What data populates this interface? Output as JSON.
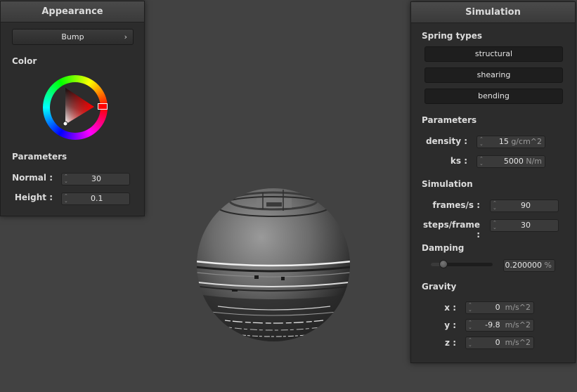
{
  "appearance": {
    "title": "Appearance",
    "shader_dropdown": "Bump",
    "color_label": "Color",
    "color_wheel": {
      "hue_color": "#ff0000"
    },
    "parameters_label": "Parameters",
    "normal": {
      "label": "Normal :",
      "value": "30"
    },
    "height": {
      "label": "Height :",
      "value": "0.1"
    }
  },
  "simulation": {
    "title": "Simulation",
    "spring_types_label": "Spring types",
    "spring_buttons": [
      "structural",
      "shearing",
      "bending"
    ],
    "parameters_label": "Parameters",
    "density": {
      "label": "density :",
      "value": "15",
      "unit": "g/cm^2"
    },
    "ks": {
      "label": "ks :",
      "value": "5000",
      "unit": "N/m"
    },
    "simulation_label": "Simulation",
    "frames_per_s": {
      "label": "frames/s :",
      "value": "90"
    },
    "steps_per_frame": {
      "label": "steps/frame :",
      "value": "30"
    },
    "damping_label": "Damping",
    "damping": {
      "value": "0.200000",
      "unit": "%",
      "level": 0.2
    },
    "gravity_label": "Gravity",
    "gravity": [
      {
        "label": "x :",
        "value": "0",
        "unit": "m/s^2"
      },
      {
        "label": "y :",
        "value": "-9.8",
        "unit": "m/s^2"
      },
      {
        "label": "z :",
        "value": "0",
        "unit": "m/s^2"
      }
    ]
  },
  "icons": {
    "dropdown_chevron": "chevron-right-icon",
    "spinner": "up-down-spinner-icon"
  }
}
